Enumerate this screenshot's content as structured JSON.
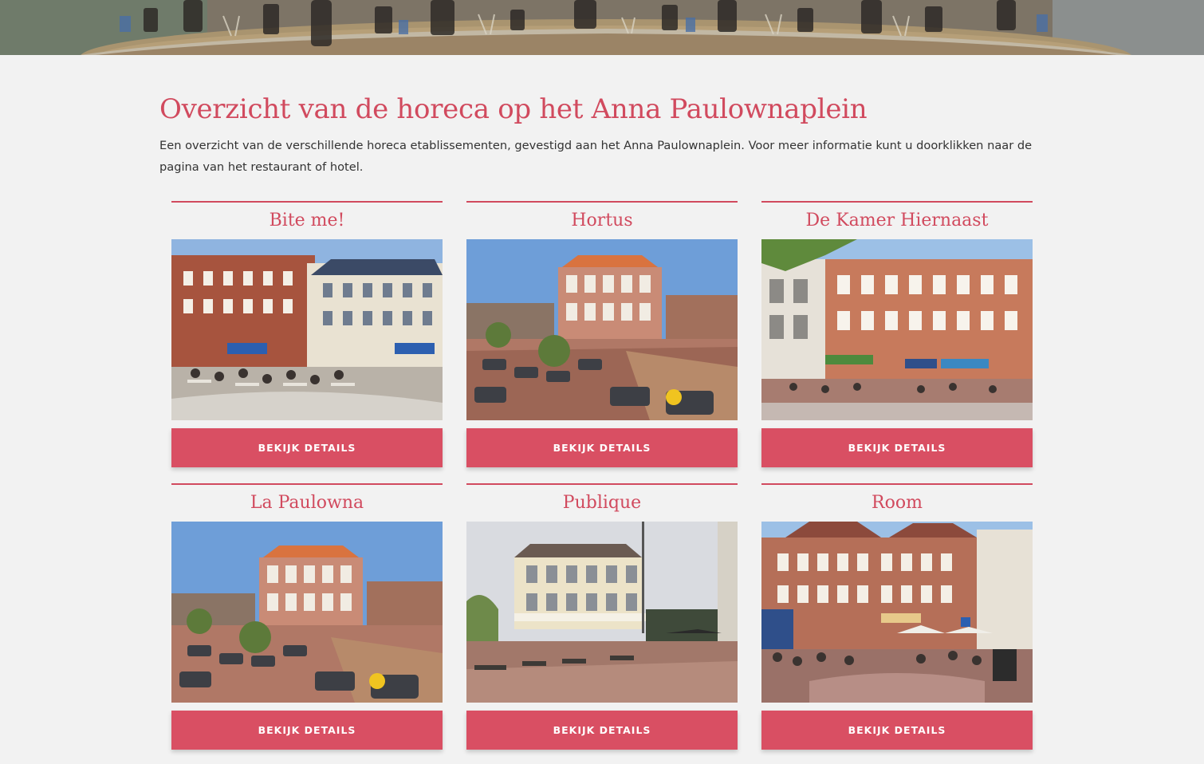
{
  "hero": {
    "image": "terrace-photo-banner"
  },
  "page": {
    "title": "Overzicht van de horeca op het Anna Paulownaplein",
    "intro": "Een overzicht van de verschillende horeca etablissementen, gevestigd aan het Anna Paulownaplein. Voor meer informatie kunt u doorklikken naar de pagina van het restaurant of hotel."
  },
  "colors": {
    "accent": "#d14a5e",
    "button": "#d94f63",
    "background": "#f2f2f2",
    "text": "#333333"
  },
  "venues": [
    {
      "name": "Bite me!",
      "button_label": "BEKIJK DETAILS",
      "image": "photo-terrace-bite-me"
    },
    {
      "name": "Hortus",
      "button_label": "BEKIJK DETAILS",
      "image": "photo-terrace-hortus"
    },
    {
      "name": "De Kamer Hiernaast",
      "button_label": "BEKIJK DETAILS",
      "image": "photo-facade-de-kamer-hiernaast"
    },
    {
      "name": "La Paulowna",
      "button_label": "BEKIJK DETAILS",
      "image": "photo-terrace-la-paulowna"
    },
    {
      "name": "Publique",
      "button_label": "BEKIJK DETAILS",
      "image": "photo-building-publique"
    },
    {
      "name": "Room",
      "button_label": "BEKIJK DETAILS",
      "image": "photo-street-room"
    }
  ]
}
